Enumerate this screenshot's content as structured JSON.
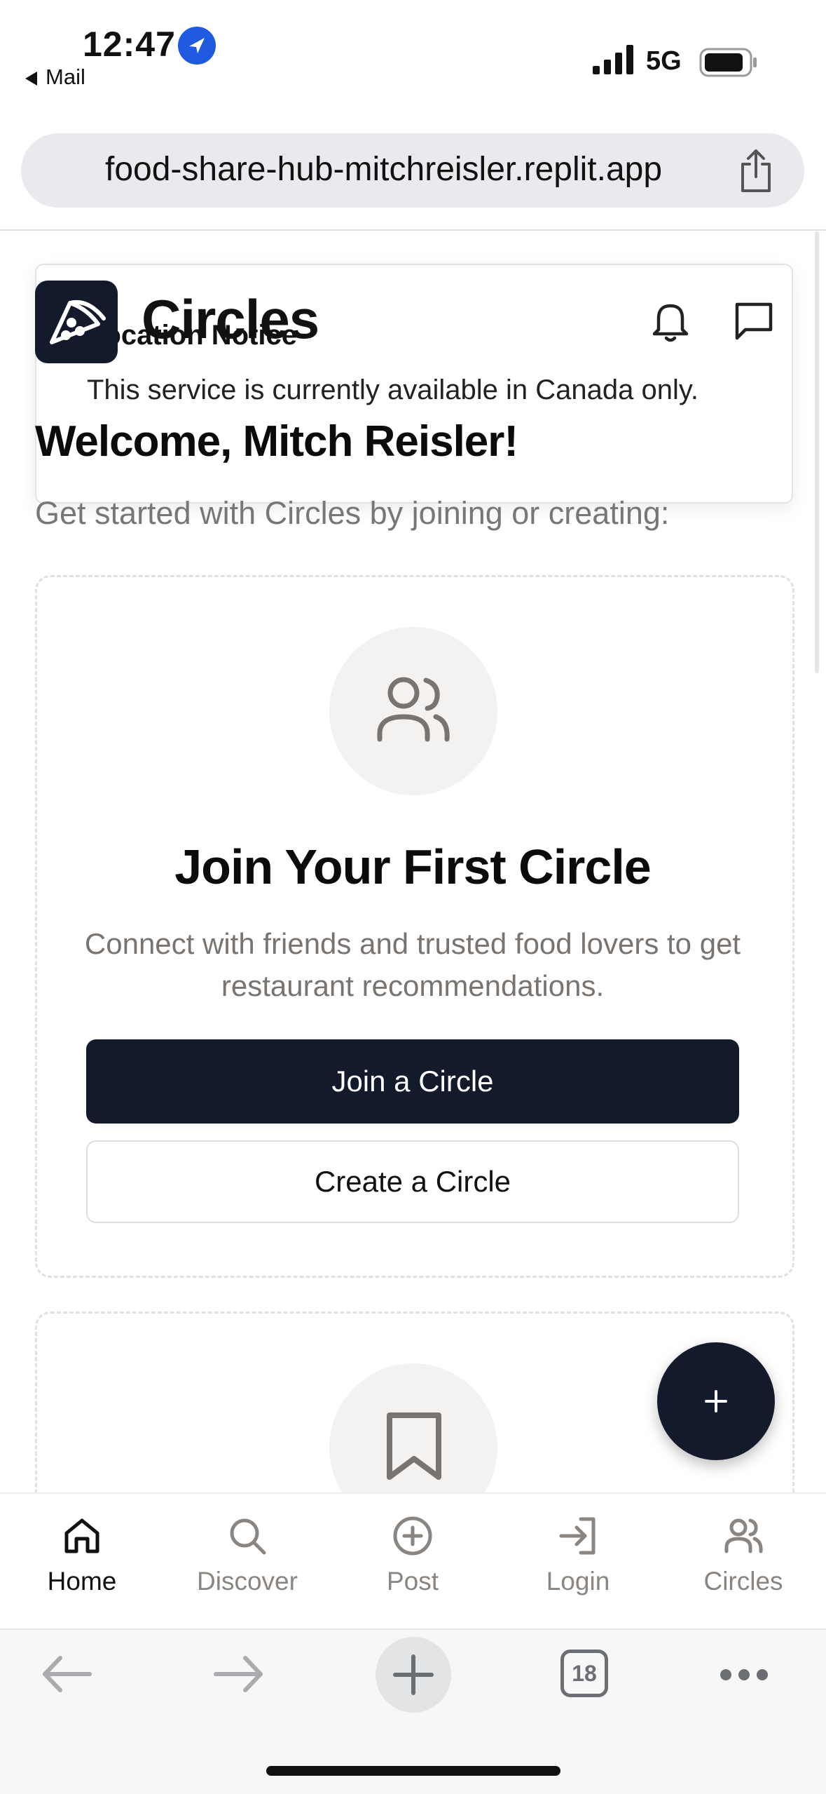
{
  "status_bar": {
    "time": "12:47",
    "back_app": "Mail",
    "network": "5G"
  },
  "browser": {
    "url": "food-share-hub-mitchreisler.replit.app",
    "tab_count": "18"
  },
  "notice": {
    "title": "Location Notice",
    "body": "This service is currently available in Canada only."
  },
  "header": {
    "brand": "Circles"
  },
  "main": {
    "welcome": "Welcome, Mitch Reisler!",
    "intro": "Get started with Circles by joining or creating:",
    "card1": {
      "title": "Join Your First Circle",
      "description": "Connect with friends and trusted food lovers to get restaurant recommendations.",
      "join_label": "Join a Circle",
      "create_label": "Create a Circle"
    },
    "fab_label": "+"
  },
  "bottom_nav": {
    "items": [
      {
        "label": "Home",
        "icon": "home-icon",
        "active": true
      },
      {
        "label": "Discover",
        "icon": "search-icon"
      },
      {
        "label": "Post",
        "icon": "plus-circle-icon"
      },
      {
        "label": "Login",
        "icon": "login-icon"
      },
      {
        "label": "Circles",
        "icon": "users-icon"
      }
    ]
  },
  "colors": {
    "primary": "#121a2c",
    "muted_text": "#7a7470",
    "nav_inactive": "#8a8580"
  }
}
